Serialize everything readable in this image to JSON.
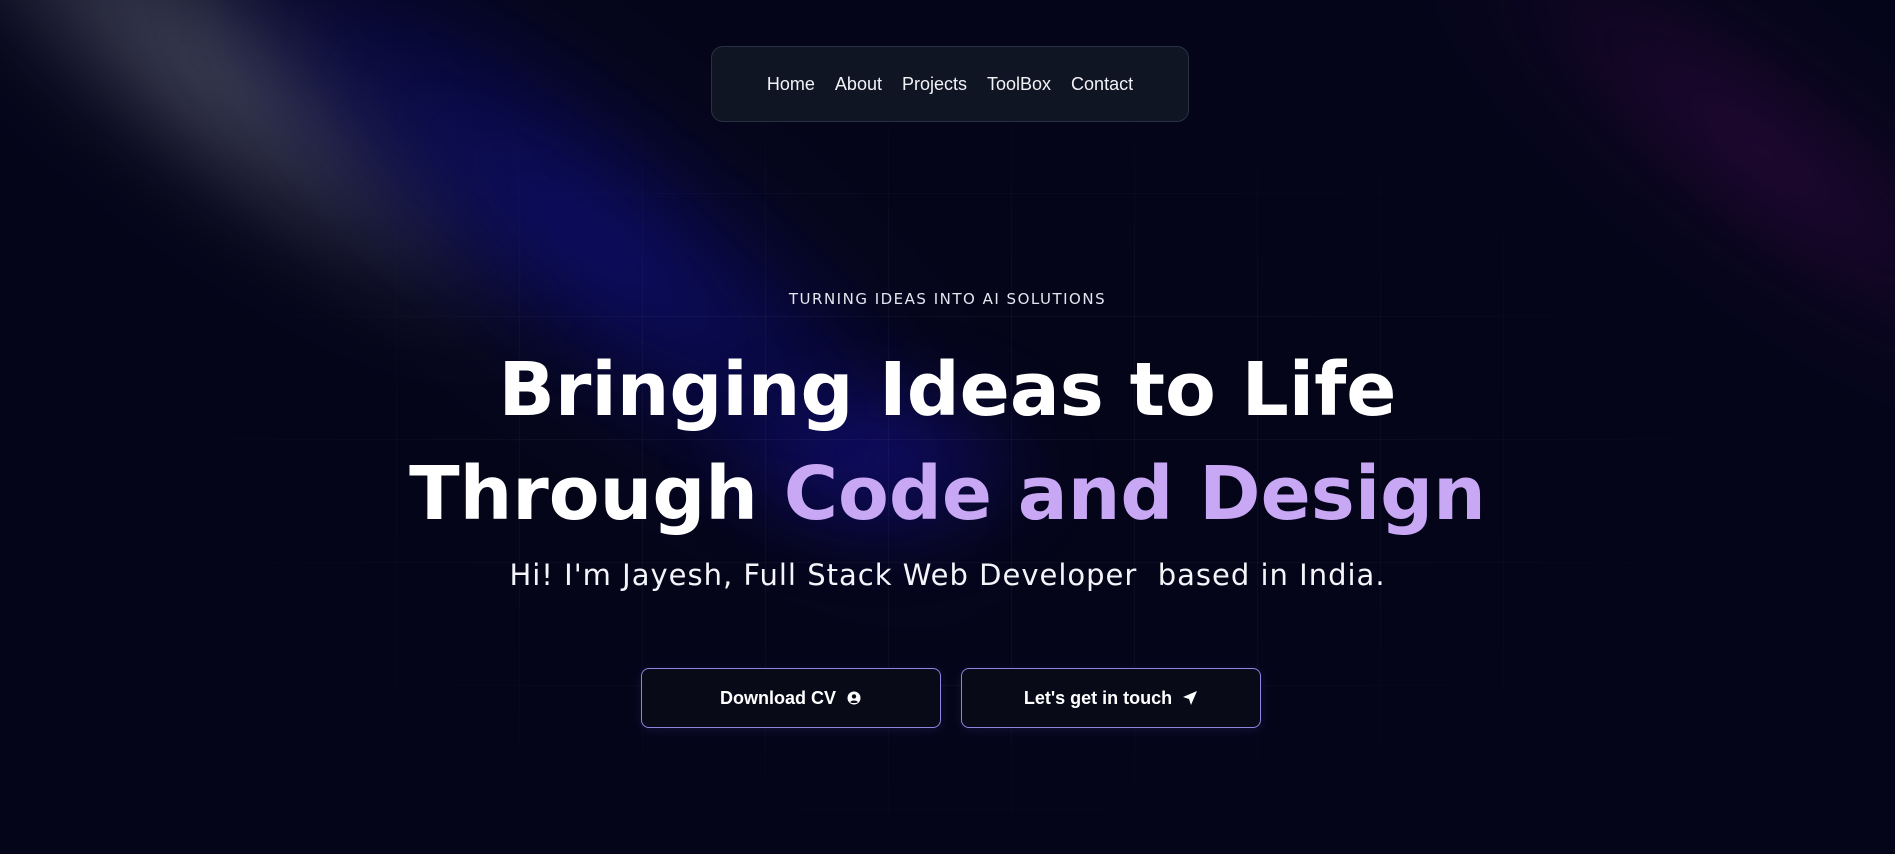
{
  "nav": {
    "items": [
      {
        "label": "Home"
      },
      {
        "label": "About"
      },
      {
        "label": "Projects"
      },
      {
        "label": "ToolBox"
      },
      {
        "label": "Contact"
      }
    ]
  },
  "hero": {
    "tagline": "TURNING IDEAS INTO AI SOLUTIONS",
    "headline_line1": "Bringing Ideas to Life",
    "headline_line2_plain": "Through ",
    "headline_line2_accent": "Code and Design",
    "subtitle": "Hi! I'm Jayesh, Full Stack Web Developer  based in India."
  },
  "buttons": {
    "download_cv": {
      "label": "Download CV",
      "icon": "user-circle-icon"
    },
    "contact": {
      "label": "Let's get in touch",
      "icon": "send-icon"
    }
  },
  "colors": {
    "background": "#05051a",
    "accent": "#c8a8f5",
    "button_border": "#8f84e0"
  }
}
